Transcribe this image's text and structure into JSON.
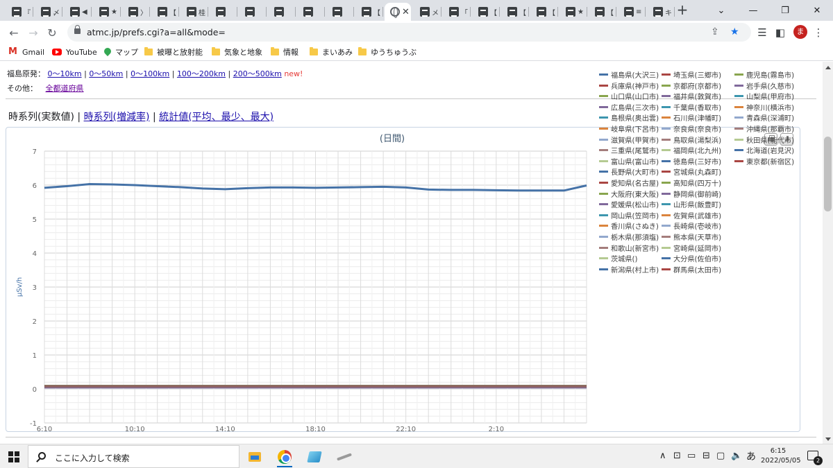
{
  "browser": {
    "tabs": [
      {
        "title": "『"
      },
      {
        "title": "〆"
      },
      {
        "title": "◀"
      },
      {
        "title": "★"
      },
      {
        "title": "〉"
      },
      {
        "title": "【"
      },
      {
        "title": "桂"
      },
      {
        "title": ""
      },
      {
        "title": ""
      },
      {
        "title": ""
      },
      {
        "title": ""
      },
      {
        "title": ""
      },
      {
        "title": "【"
      },
      {
        "title": "",
        "active": true
      },
      {
        "title": "メ"
      },
      {
        "title": "「"
      },
      {
        "title": "【"
      },
      {
        "title": "【"
      },
      {
        "title": "【"
      },
      {
        "title": "★"
      },
      {
        "title": "【"
      },
      {
        "title": "≡"
      },
      {
        "title": "キ"
      }
    ],
    "url": "atmc.jp/prefs.cgi?a=all&mode=",
    "avatar_letter": "ま",
    "bookmarks": [
      {
        "label": "Gmail",
        "icon": "gmail-icon"
      },
      {
        "label": "YouTube",
        "icon": "youtube-icon"
      },
      {
        "label": "マップ",
        "icon": "maps-icon"
      },
      {
        "label": "被曝と放射能",
        "icon": "folder-icon"
      },
      {
        "label": "気象と地象",
        "icon": "folder-icon"
      },
      {
        "label": "情報",
        "icon": "folder-icon"
      },
      {
        "label": "まいあみ",
        "icon": "folder-icon"
      },
      {
        "label": "ゆうちゅうぶ",
        "icon": "folder-icon"
      }
    ]
  },
  "page": {
    "row1_label": "福島原発：",
    "row1_links": [
      "0〜10km",
      "0〜50km",
      "0〜100km",
      "100〜200km",
      "200〜500km"
    ],
    "row1_new": "new!",
    "row2_label": "その他：",
    "row2_link": "全都道府県",
    "mode_current": "時系列(実数値)",
    "mode_links": [
      "時系列(増減率)",
      "統計値(平均、最少、最大)"
    ],
    "separator": "|"
  },
  "chart_data": {
    "type": "line",
    "title": "(日間)",
    "ylabel": "μSv/h",
    "xlabel": "",
    "ylim": [
      -1,
      7
    ],
    "yticks": [
      -1,
      0,
      1,
      2,
      3,
      4,
      5,
      6,
      7
    ],
    "x_tick_labels": [
      "6:10",
      "10:10",
      "14:10",
      "18:10",
      "22:10",
      "2:10"
    ],
    "x_points": 25,
    "grid": true,
    "legend_position": "right",
    "series": [
      {
        "name": "福島県(大沢三)",
        "color": "#4572a7",
        "values": [
          5.92,
          5.97,
          6.03,
          6.02,
          6.0,
          5.97,
          5.94,
          5.9,
          5.88,
          5.91,
          5.93,
          5.93,
          5.92,
          5.93,
          5.94,
          5.95,
          5.93,
          5.87,
          5.86,
          5.86,
          5.85,
          5.84,
          5.84,
          5.84,
          5.99
        ]
      },
      {
        "name": "兵庫県(神戸市)",
        "color": "#aa4643",
        "values": [
          0.08,
          0.08,
          0.08,
          0.08,
          0.08,
          0.08,
          0.08,
          0.08,
          0.08,
          0.08,
          0.08,
          0.08,
          0.08,
          0.08,
          0.08,
          0.08,
          0.08,
          0.08,
          0.08,
          0.08,
          0.08,
          0.08,
          0.08,
          0.08,
          0.08
        ]
      },
      {
        "name": "山口県(山口市)",
        "color": "#89a54e",
        "values": [
          0.09,
          0.09,
          0.09,
          0.09,
          0.09,
          0.09,
          0.09,
          0.09,
          0.09,
          0.09,
          0.09,
          0.09,
          0.09,
          0.09,
          0.09,
          0.09,
          0.09,
          0.09,
          0.09,
          0.09,
          0.09,
          0.09,
          0.09,
          0.09,
          0.09
        ]
      },
      {
        "name": "広島県(三次市)",
        "color": "#80699b",
        "values": [
          0.05,
          0.05,
          0.05,
          0.05,
          0.05,
          0.05,
          0.05,
          0.05,
          0.05,
          0.05,
          0.05,
          0.05,
          0.05,
          0.05,
          0.05,
          0.05,
          0.05,
          0.05,
          0.05,
          0.05,
          0.05,
          0.05,
          0.05,
          0.05,
          0.05
        ]
      },
      {
        "name": "島根県(奥出雲)",
        "color": "#3d96ae",
        "values": []
      },
      {
        "name": "岐阜県(下呂市)",
        "color": "#db843d",
        "values": []
      },
      {
        "name": "滋賀県(甲賀市)",
        "color": "#92a8cd",
        "values": []
      },
      {
        "name": "三重県(尾鷲市)",
        "color": "#a47d7c",
        "values": []
      },
      {
        "name": "富山県(富山市)",
        "color": "#b5ca92",
        "values": []
      },
      {
        "name": "長野県(大町市)",
        "color": "#4572a7",
        "values": []
      },
      {
        "name": "愛知県(名古屋)",
        "color": "#aa4643",
        "values": []
      },
      {
        "name": "大阪府(東大阪)",
        "color": "#89a54e",
        "values": []
      },
      {
        "name": "愛媛県(松山市)",
        "color": "#80699b",
        "values": []
      },
      {
        "name": "岡山県(笠岡市)",
        "color": "#3d96ae",
        "values": []
      },
      {
        "name": "香川県(さぬき)",
        "color": "#db843d",
        "values": []
      },
      {
        "name": "栃木県(那須塩)",
        "color": "#92a8cd",
        "values": []
      },
      {
        "name": "和歌山(新宮市)",
        "color": "#a47d7c",
        "values": []
      },
      {
        "name": "茨城県()",
        "color": "#b5ca92",
        "values": []
      },
      {
        "name": "新潟県(村上市)",
        "color": "#4572a7",
        "values": []
      },
      {
        "name": "埼玉県(三郷市)",
        "color": "#aa4643",
        "values": []
      },
      {
        "name": "京都府(京都市)",
        "color": "#89a54e",
        "values": []
      },
      {
        "name": "福井県(敦賀市)",
        "color": "#80699b",
        "values": []
      },
      {
        "name": "千葉県(香取市)",
        "color": "#3d96ae",
        "values": []
      },
      {
        "name": "石川県(津幡町)",
        "color": "#db843d",
        "values": []
      },
      {
        "name": "奈良県(奈良市)",
        "color": "#92a8cd",
        "values": []
      },
      {
        "name": "鳥取県(湯梨浜)",
        "color": "#a47d7c",
        "values": []
      },
      {
        "name": "福岡県(北九州)",
        "color": "#b5ca92",
        "values": []
      },
      {
        "name": "徳島県(三好市)",
        "color": "#4572a7",
        "values": []
      },
      {
        "name": "宮城県(丸森町)",
        "color": "#aa4643",
        "values": []
      },
      {
        "name": "高知県(四万十)",
        "color": "#89a54e",
        "values": []
      },
      {
        "name": "静岡県(御前崎)",
        "color": "#80699b",
        "values": []
      },
      {
        "name": "山形県(飯豊町)",
        "color": "#3d96ae",
        "values": []
      },
      {
        "name": "佐賀県(武雄市)",
        "color": "#db843d",
        "values": []
      },
      {
        "name": "長崎県(壱岐市)",
        "color": "#92a8cd",
        "values": []
      },
      {
        "name": "熊本県(天草市)",
        "color": "#a47d7c",
        "values": []
      },
      {
        "name": "宮崎県(延岡市)",
        "color": "#b5ca92",
        "values": []
      },
      {
        "name": "大分県(佐伯市)",
        "color": "#4572a7",
        "values": []
      },
      {
        "name": "群馬県(太田市)",
        "color": "#aa4643",
        "values": []
      },
      {
        "name": "鹿児島(霧島市)",
        "color": "#89a54e",
        "values": []
      },
      {
        "name": "岩手県(久慈市)",
        "color": "#80699b",
        "values": []
      },
      {
        "name": "山梨県(甲府市)",
        "color": "#3d96ae",
        "values": []
      },
      {
        "name": "神奈川(横浜市)",
        "color": "#db843d",
        "values": []
      },
      {
        "name": "青森県(深浦町)",
        "color": "#92a8cd",
        "values": []
      },
      {
        "name": "沖縄県(那覇市)",
        "color": "#a47d7c",
        "values": []
      },
      {
        "name": "秋田県(能代市)",
        "color": "#b5ca92",
        "values": []
      },
      {
        "name": "北海道(岩見沢)",
        "color": "#4572a7",
        "values": []
      },
      {
        "name": "東京都(新宿区)",
        "color": "#aa4643",
        "values": []
      }
    ]
  },
  "taskbar": {
    "search_placeholder": "ここに入力して検索",
    "ime": "あ",
    "time": "6:15",
    "date": "2022/05/05",
    "notification_count": "2"
  }
}
